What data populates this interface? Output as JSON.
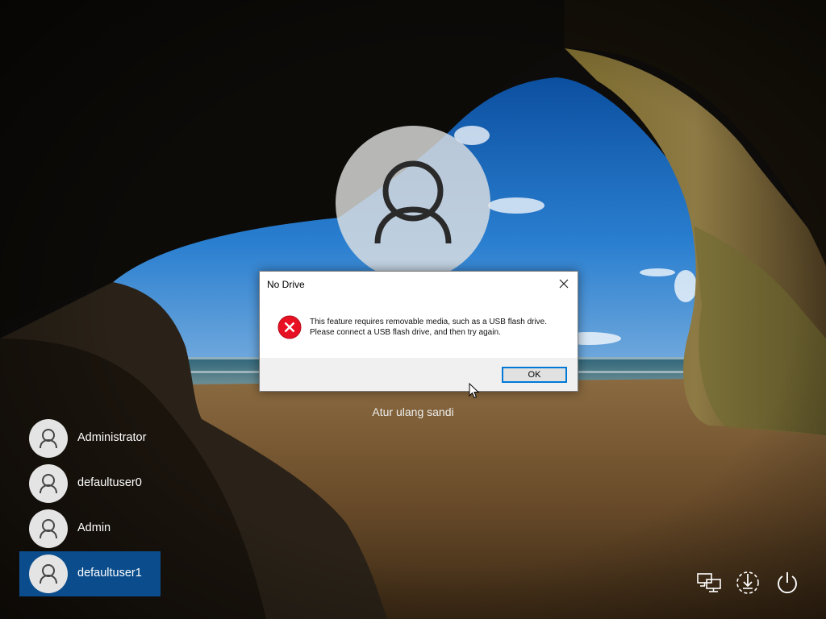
{
  "lock_screen": {
    "reset_password_link": "Atur ulang sandi"
  },
  "users": [
    {
      "name": "Administrator",
      "selected": false
    },
    {
      "name": "defaultuser0",
      "selected": false
    },
    {
      "name": "Admin",
      "selected": false
    },
    {
      "name": "defaultuser1",
      "selected": true
    }
  ],
  "dialog": {
    "title": "No Drive",
    "message": "This feature requires removable media, such as a USB flash drive. Please connect a USB flash drive, and then try again.",
    "ok_label": "OK",
    "icon": "error-icon"
  },
  "tray": {
    "icons": [
      "network-icon",
      "ease-of-access-icon",
      "power-icon"
    ]
  },
  "colors": {
    "selection": "#0b4d8c",
    "dialog_accent": "#0078d7",
    "error_red": "#e81123"
  }
}
